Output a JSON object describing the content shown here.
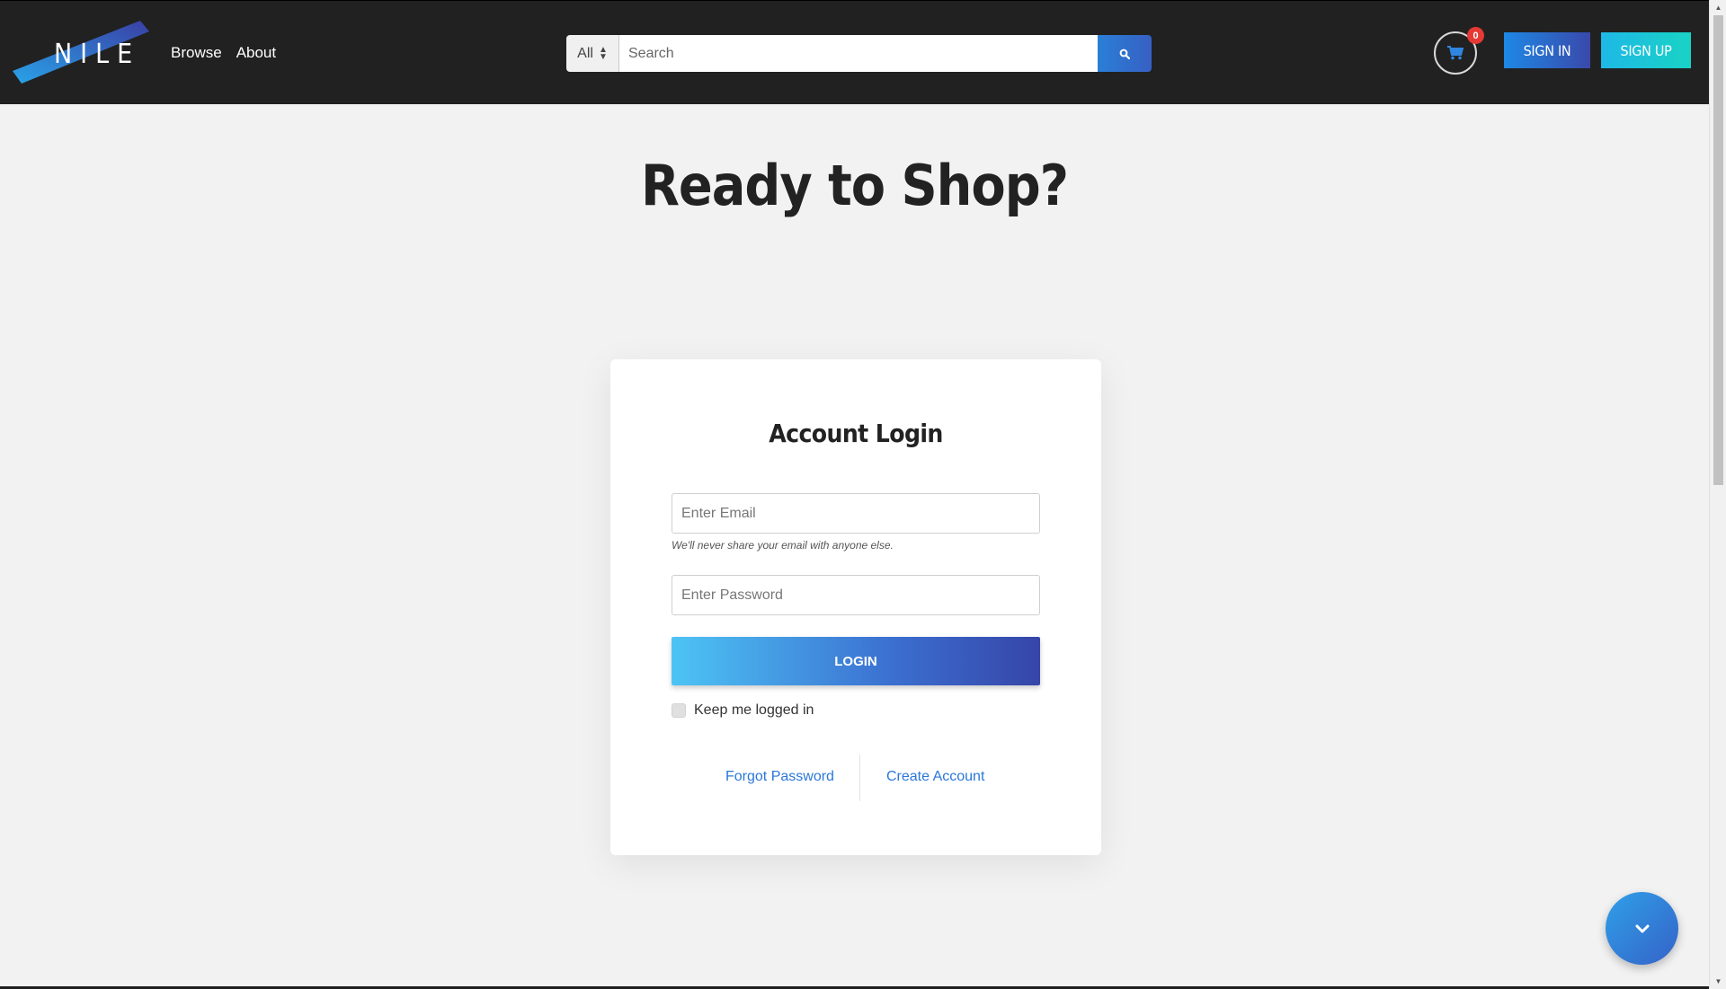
{
  "brand": {
    "logo_text": "NILE",
    "accent_start": "#1e88e5",
    "accent_end": "#3949ab"
  },
  "nav": {
    "browse": "Browse",
    "about": "About"
  },
  "search": {
    "category": "All",
    "placeholder": "Search",
    "button_icon": "search-icon"
  },
  "cart": {
    "count": "0",
    "icon": "cart-icon"
  },
  "auth": {
    "sign_in": "SIGN IN",
    "sign_up": "SIGN UP"
  },
  "hero": {
    "title": "Ready to Shop?"
  },
  "login_card": {
    "title": "Account Login",
    "email_placeholder": "Enter Email",
    "email_help": "We'll never share your email with anyone else.",
    "password_placeholder": "Enter Password",
    "login_label": "LOGIN",
    "remember_label": "Keep me logged in",
    "forgot_password": "Forgot Password",
    "create_account": "Create Account"
  },
  "fab": {
    "icon": "chevron-down-icon"
  }
}
